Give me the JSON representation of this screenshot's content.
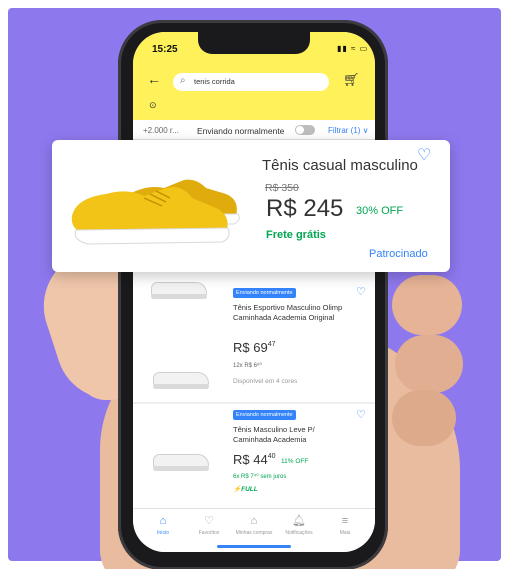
{
  "status": {
    "time": "15:25",
    "icons": "▮▮ ≈ ▭"
  },
  "search": {
    "query": "tenis corrida"
  },
  "filters": {
    "count": "+2.000 r...",
    "shipping_toggle_label": "Enviando normalmente",
    "filter_link": "Filtrar (1) ∨"
  },
  "featured": {
    "title": "Tênis casual masculino",
    "old_price": "R$ 350",
    "price": "R$ 245",
    "discount": "30% OFF",
    "shipping": "Frete grátis",
    "sponsored": "Patrocinado",
    "shoe_color": "#f2c418"
  },
  "products": [
    {
      "badge": "Enviando normalmente",
      "title": "Tênis Esportivo Masculino Olimp Caminhada Academia Original",
      "price_main": "R$ 69",
      "price_cents": "47",
      "installments": "12x R$ 6⁸⁰",
      "note": "Disponível em 4 cores"
    },
    {
      "badge": "Enviando normalmente",
      "title": "Tênis Masculino Leve P/ Caminhada Academia",
      "price_main": "R$ 44",
      "price_cents": "40",
      "discount": "11% OFF",
      "installments": "6x R$ 7⁴⁰ sem juros",
      "tag": "⚡FULL"
    }
  ],
  "tabs": [
    {
      "label": "Início",
      "icon": "home-icon"
    },
    {
      "label": "Favoritos",
      "icon": "heart-icon"
    },
    {
      "label": "Minhas compras",
      "icon": "bag-icon"
    },
    {
      "label": "Notificações",
      "icon": "bell-icon"
    },
    {
      "label": "Mais",
      "icon": "menu-icon"
    }
  ],
  "colors": {
    "background": "#8e78ee",
    "header_yellow": "#fff159",
    "accent_blue": "#3483fa",
    "green": "#00a650"
  }
}
